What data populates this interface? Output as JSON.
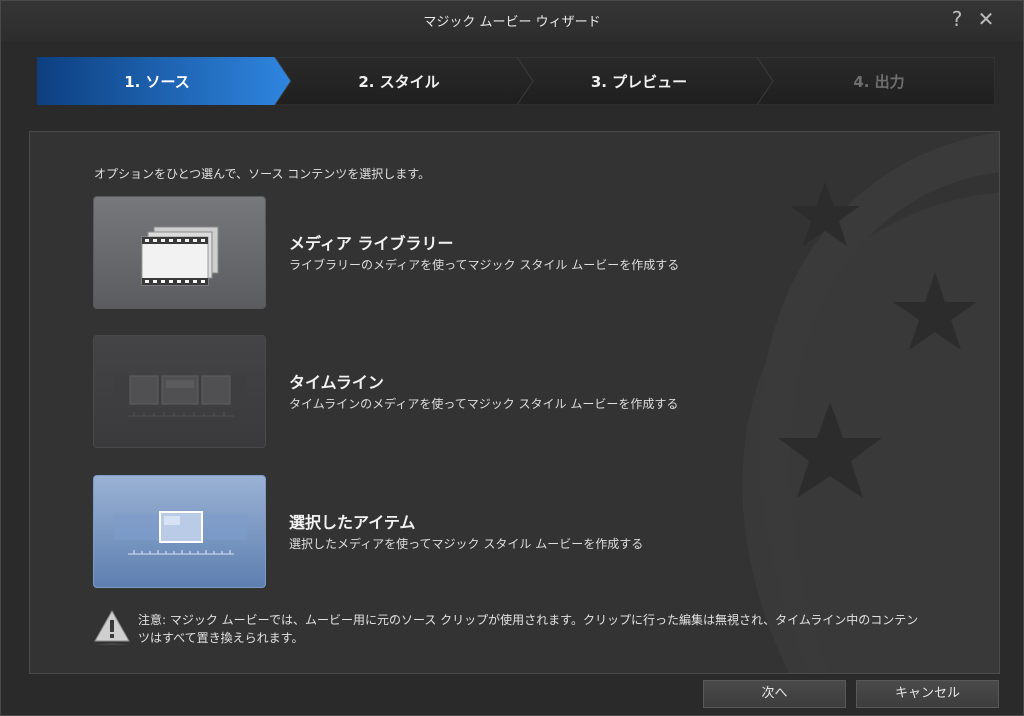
{
  "window": {
    "title": "マジック ムービー ウィザード",
    "help_icon": "?",
    "close_icon": "✕"
  },
  "steps": [
    {
      "label": "1. ソース",
      "state": "active"
    },
    {
      "label": "2. スタイル",
      "state": "normal"
    },
    {
      "label": "3. プレビュー",
      "state": "normal"
    },
    {
      "label": "4. 出力",
      "state": "disabled"
    }
  ],
  "instruction": "オプションをひとつ選んで、ソース コンテンツを選択します。",
  "options": [
    {
      "title": "メディア ライブラリー",
      "description": "ライブラリーのメディアを使ってマジック スタイル ムービーを作成する",
      "icon": "film-stack-icon"
    },
    {
      "title": "タイムライン",
      "description": "タイムラインのメディアを使ってマジック スタイル ムービーを作成する",
      "icon": "timeline-icon"
    },
    {
      "title": "選択したアイテム",
      "description": "選択したメディアを使ってマジック スタイル ムービーを作成する",
      "icon": "selected-item-icon"
    }
  ],
  "warning": {
    "icon": "warning-triangle-icon",
    "text": "注意: マジック ムービーでは、ムービー用に元のソース クリップが使用されます。クリップに行った編集は無視され、タイムライン中のコンテンツはすべて置き換えられます。"
  },
  "buttons": {
    "next": "次へ",
    "cancel": "キャンセル"
  },
  "colors": {
    "active_step": "#1f6fc4",
    "selected_tile": "#6f8fc0",
    "background": "#333333"
  }
}
